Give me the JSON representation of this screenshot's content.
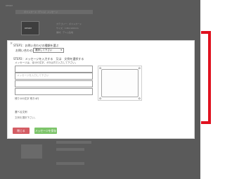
{
  "background": {
    "header_text": "DENiM",
    "title_bar_text": "ポストカード（デニム）メッセージ",
    "badge_text": "DENiM",
    "items": [
      "カテゴリー：ポストカード",
      "サイズ：148×100mm",
      "素材：デニム生地"
    ]
  },
  "modal": {
    "close_glyph": "×",
    "step1_label": "STEP1：お問い合わせの種類を選ぶ",
    "type_label": "お問い合わせの種類",
    "type_select_value": "選択して下さい",
    "step2_label": "STEP2：メッセージを入力する　又は　文例を選択する",
    "step2_hint": "メッセージは、全100文字、4行以内で入力して下さい。",
    "message_placeholder": "メッセージを入力して下さい",
    "remaining_text": "残り100文字 残り4行",
    "selected_title": "選べる文例",
    "selected_empty": "文例を選択下さい。",
    "close_button": "閉じる",
    "send_button": "メッセージを保存"
  },
  "colors": {
    "indicator": "#e0111f",
    "close_button": "#d45d64",
    "send_button": "#7dc46a"
  }
}
